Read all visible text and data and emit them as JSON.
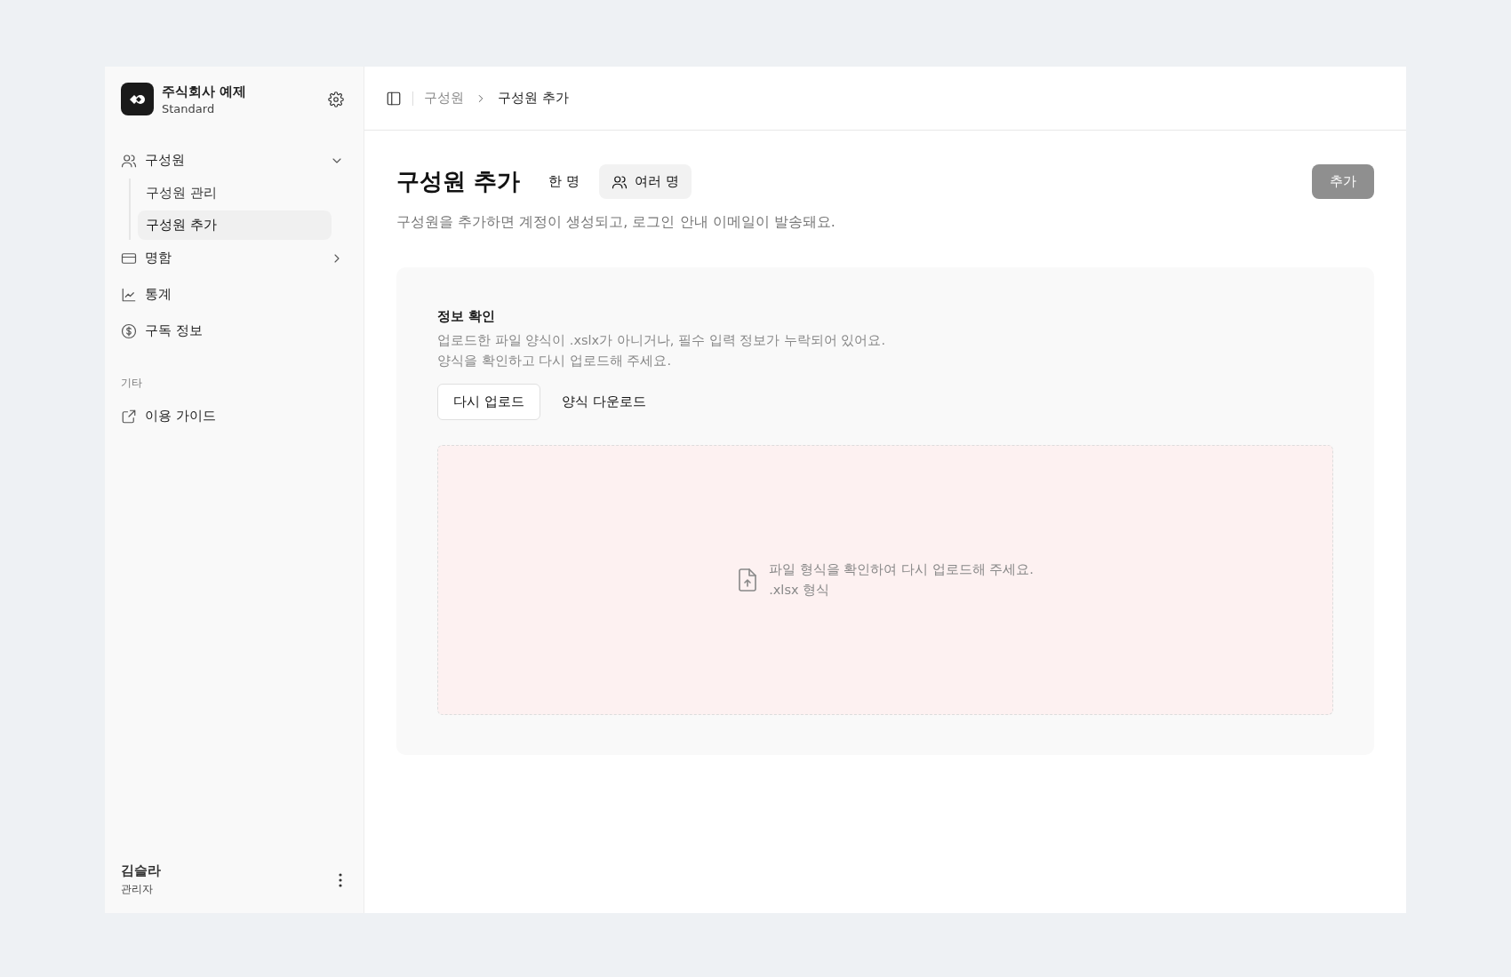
{
  "sidebar": {
    "org": {
      "name": "주식회사 예제",
      "plan": "Standard"
    },
    "nav": [
      {
        "label": "구성원",
        "expanded": true,
        "children": [
          {
            "label": "구성원 관리",
            "selected": false
          },
          {
            "label": "구성원 추가",
            "selected": true
          }
        ]
      },
      {
        "label": "명함",
        "expanded": false
      },
      {
        "label": "통계"
      },
      {
        "label": "구독 정보"
      }
    ],
    "section_label": "기타",
    "extra": [
      {
        "label": "이용 가이드"
      }
    ],
    "user": {
      "name": "김슬라",
      "role": "관리자"
    }
  },
  "breadcrumb": [
    {
      "label": "구성원",
      "current": false
    },
    {
      "label": "구성원 추가",
      "current": true
    }
  ],
  "page": {
    "title": "구성원 추가",
    "tabs": [
      {
        "label": "한 명",
        "selected": false
      },
      {
        "label": "여러 명",
        "selected": true
      }
    ],
    "add_button": {
      "label": "추가",
      "disabled": true
    },
    "description": "구성원을 추가하면 계정이 생성되고, 로그인 안내 이메일이 발송돼요."
  },
  "error_card": {
    "title": "정보 확인",
    "lines": [
      "업로드한 파일 양식이 .xslx가 아니거나, 필수 입력 정보가 누락되어 있어요.",
      "양식을 확인하고 다시 업로드해 주세요."
    ],
    "buttons": [
      {
        "label": "다시 업로드",
        "kind": "outline"
      },
      {
        "label": "양식 다운로드",
        "kind": "ghost"
      }
    ],
    "dropzone": {
      "message": "파일 형식을 확인하여 다시 업로드해 주세요.",
      "hint": ".xlsx 형식",
      "error": true
    }
  }
}
